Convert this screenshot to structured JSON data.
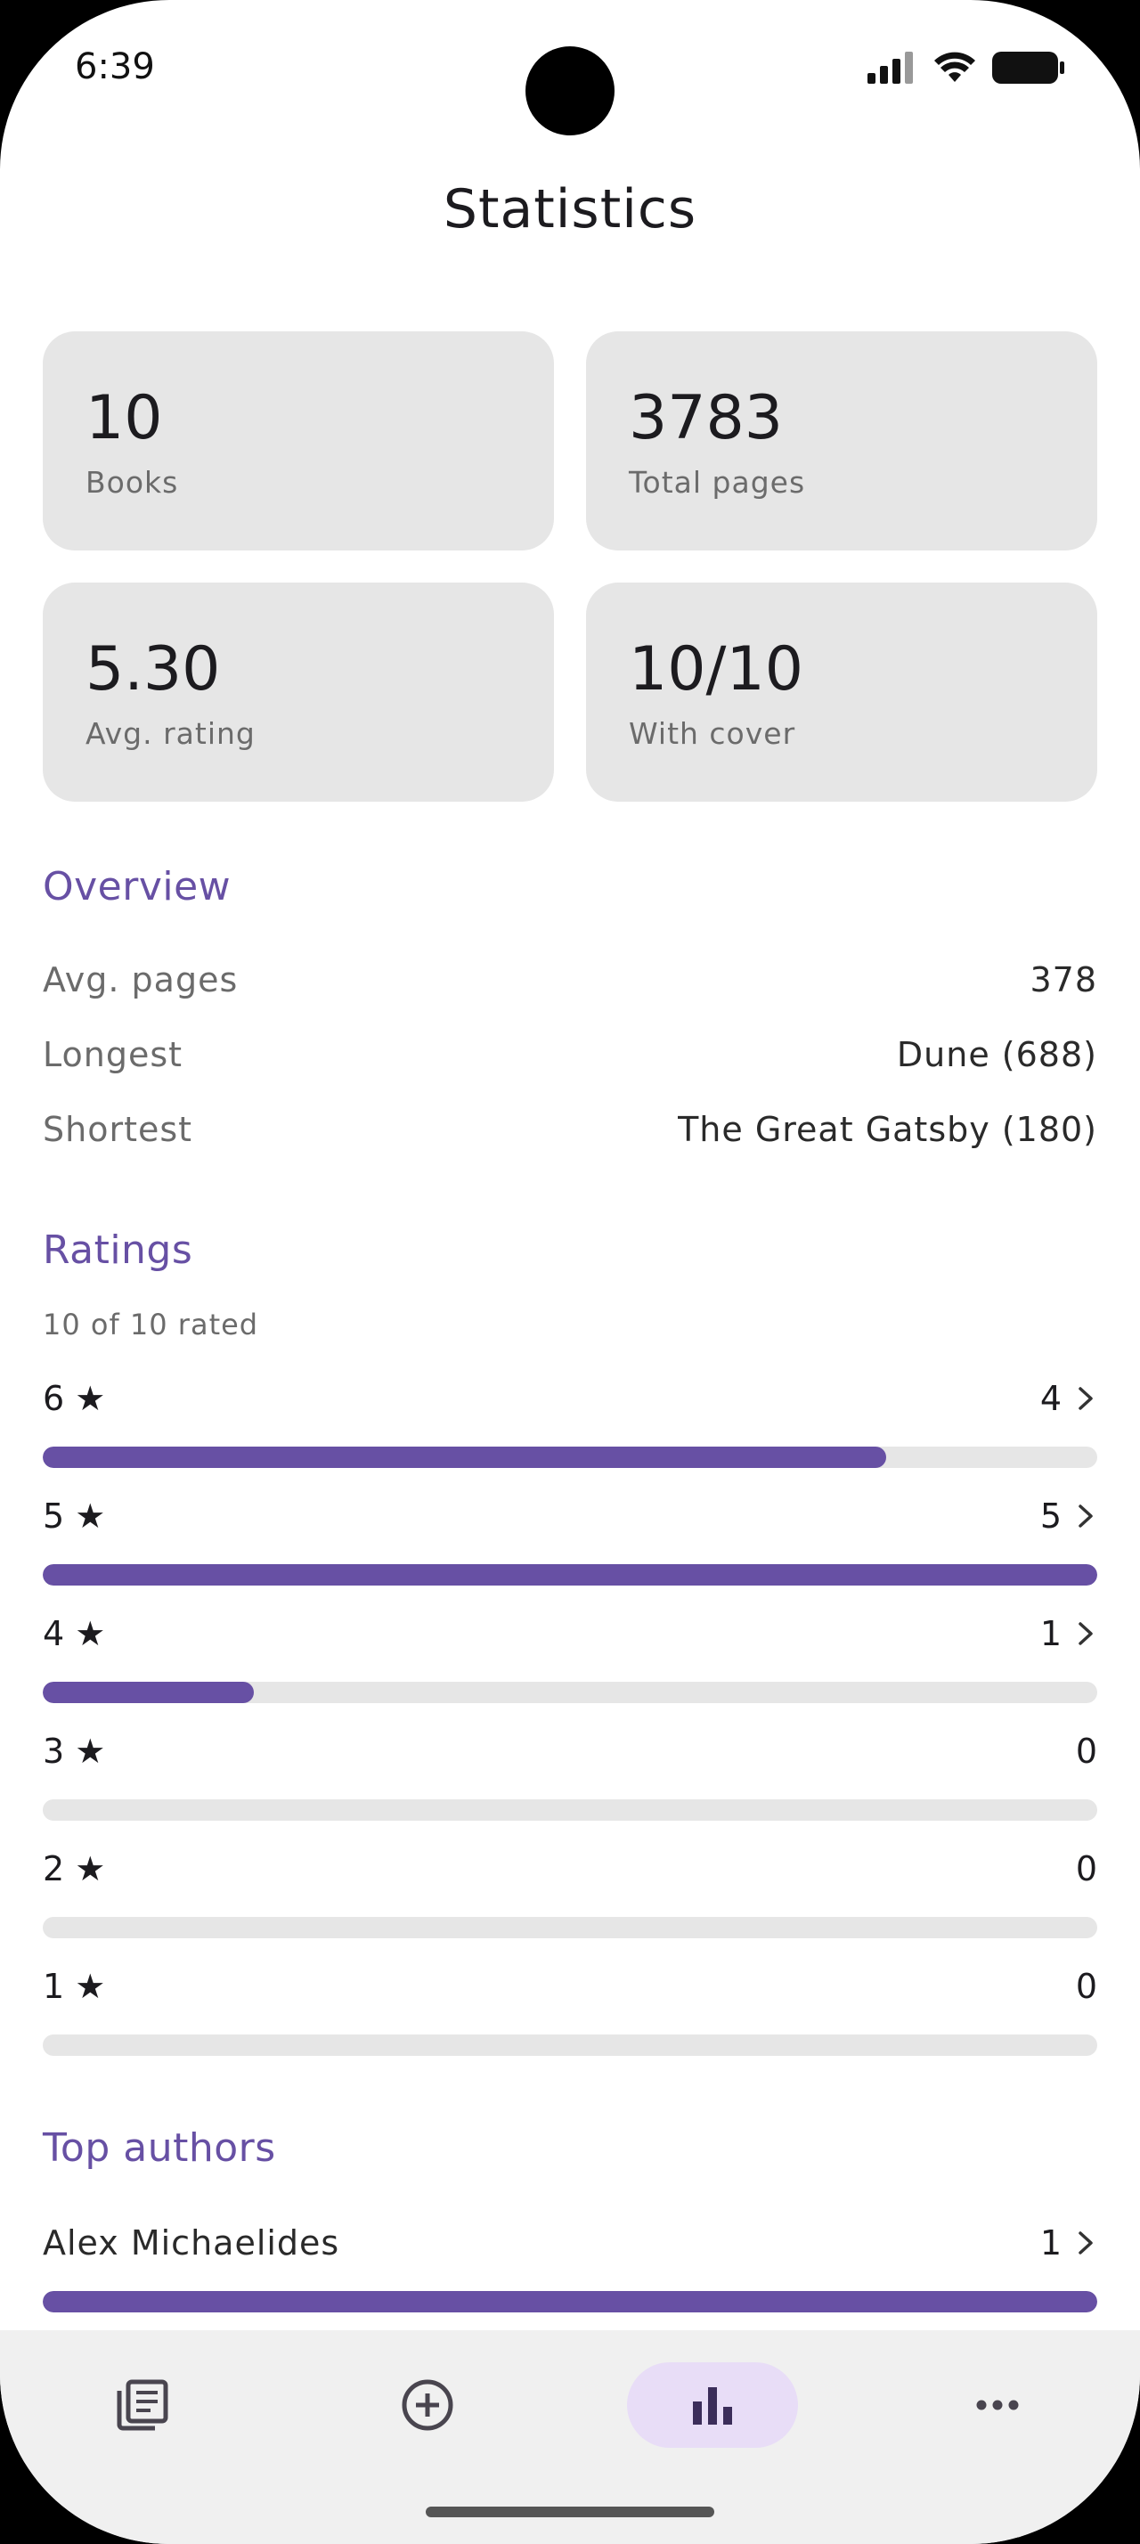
{
  "status_bar": {
    "time": "6:39"
  },
  "app": {
    "title": "Statistics"
  },
  "cards": [
    {
      "value": "10",
      "label": "Books"
    },
    {
      "value": "3783",
      "label": "Total pages"
    },
    {
      "value": "5.30",
      "label": "Avg. rating"
    },
    {
      "value": "10/10",
      "label": "With cover"
    }
  ],
  "overview": {
    "title": "Overview",
    "rows": [
      {
        "label": "Avg. pages",
        "value": "378"
      },
      {
        "label": "Longest",
        "value": "Dune (688)"
      },
      {
        "label": "Shortest",
        "value": "The Great Gatsby (180)"
      }
    ]
  },
  "ratings": {
    "title": "Ratings",
    "caption": "10 of 10 rated",
    "rows": [
      {
        "stars": "6 ★",
        "count": "4",
        "fraction": 0.8,
        "has_chevron": true
      },
      {
        "stars": "5 ★",
        "count": "5",
        "fraction": 1.0,
        "has_chevron": true
      },
      {
        "stars": "4 ★",
        "count": "1",
        "fraction": 0.2,
        "has_chevron": true
      },
      {
        "stars": "3 ★",
        "count": "0",
        "fraction": 0.0,
        "has_chevron": false
      },
      {
        "stars": "2 ★",
        "count": "0",
        "fraction": 0.0,
        "has_chevron": false
      },
      {
        "stars": "1 ★",
        "count": "0",
        "fraction": 0.0,
        "has_chevron": false
      }
    ]
  },
  "top_authors": {
    "title": "Top authors",
    "rows": [
      {
        "name": "Alex Michaelides",
        "count": "1",
        "fraction": 1.0
      }
    ]
  },
  "nav": {
    "items": [
      {
        "icon": "library-icon",
        "active": false
      },
      {
        "icon": "add-circle-icon",
        "active": false
      },
      {
        "icon": "bar-chart-icon",
        "active": true
      },
      {
        "icon": "more-horizontal-icon",
        "active": false
      }
    ]
  },
  "colors": {
    "accent": "#6750a4",
    "card_bg": "#e6e6e6",
    "active_nav": "#e8ddf7"
  }
}
